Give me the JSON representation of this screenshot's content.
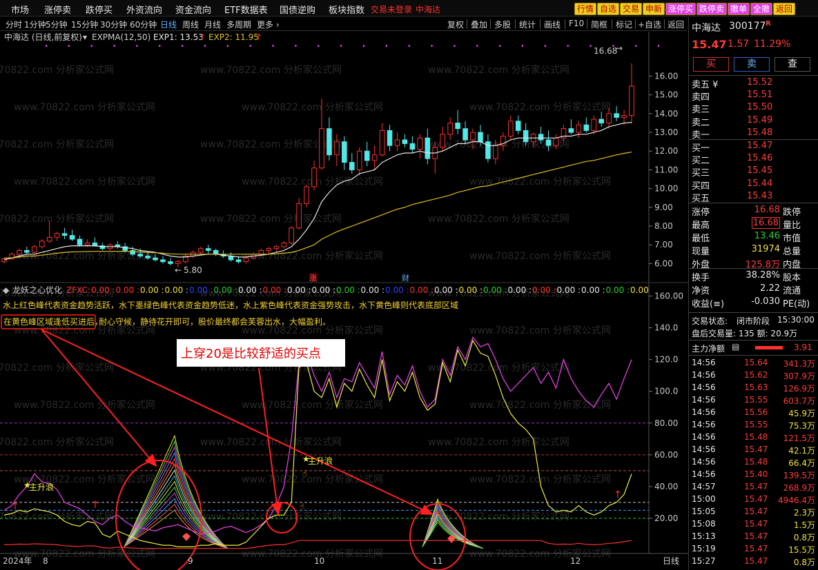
{
  "menu": {
    "items": [
      "市场",
      "涨停卖",
      "跌停买",
      "外资流向",
      "资金流向",
      "ETF数据表",
      "国债逆购",
      "板块指数"
    ],
    "login_status": "交易未登录",
    "stock_flag": "中海达",
    "quick_buttons": [
      {
        "label": "行情",
        "bg": "#f0d020",
        "fg": "#b00000"
      },
      {
        "label": "自选",
        "bg": "#f0d020",
        "fg": "#b00000"
      },
      {
        "label": "交易",
        "bg": "#f0d020",
        "fg": "#b00000"
      },
      {
        "label": "申新",
        "bg": "#f0d020",
        "fg": "#b00000"
      },
      {
        "label": "涨停买",
        "bg": "#e040e0",
        "fg": "#ffffff"
      },
      {
        "label": "跌停卖",
        "bg": "#e040e0",
        "fg": "#ffffff"
      },
      {
        "label": "撤单",
        "bg": "#e040e0",
        "fg": "#ffffff"
      },
      {
        "label": "全撤",
        "bg": "#e040e0",
        "fg": "#ffffff"
      },
      {
        "label": "返回",
        "bg": "#f0d020",
        "fg": "#b00000"
      }
    ]
  },
  "periods": {
    "items": [
      "分时",
      "1分钟",
      "5分钟",
      "15分钟",
      "30分钟",
      "60分钟",
      "日线",
      "周线",
      "月线",
      "多周期",
      "更多 ›"
    ],
    "active": "日线"
  },
  "tools": [
    "复权",
    "叠加",
    "多股",
    "统计",
    "画线",
    "F10",
    "简框",
    "标记",
    "+自选",
    "返回"
  ],
  "main_chart": {
    "title": "中海达 (日线,前复权)",
    "indicator": "EXPMA(12,50)",
    "exp1_label": "EXP1: 13.53",
    "exp1_arrow": "↑",
    "exp2_label": "EXP2: 11.95",
    "exp2_arrow": "↑",
    "high_label": "16.68",
    "low_label": "5.80",
    "event_zhang": "涨",
    "event_cai": "财",
    "y_ticks": [
      "16.00",
      "15.00",
      "14.00",
      "13.00",
      "12.00",
      "11.00",
      "10.00",
      "9.00",
      "8.00",
      "7.00",
      "6.00"
    ]
  },
  "sub_chart": {
    "title": "龙妖之心优化",
    "zfxc_label": "ZFXC:",
    "zfxc_values": [
      {
        "t": "0.00",
        "c": "#ff3030"
      },
      {
        "t": "0.00",
        "c": "#ff3030"
      },
      {
        "t": "0.00",
        "c": "#f0e040"
      },
      {
        "t": "0.00",
        "c": "#f0e040"
      },
      {
        "t": "0.00",
        "c": "#3040ff"
      },
      {
        "t": "0.00",
        "c": "#27d127"
      },
      {
        "t": "0.00",
        "c": "#e8e8e8"
      },
      {
        "t": "0.00",
        "c": "#ff3030"
      },
      {
        "t": "0.00",
        "c": "#e8e8e8"
      },
      {
        "t": "0.00",
        "c": "#e8e8e8"
      },
      {
        "t": "0.00",
        "c": "#27d127"
      },
      {
        "t": "0.00",
        "c": "#e8e8e8"
      },
      {
        "t": "0.00",
        "c": "#3040ff"
      },
      {
        "t": "0.00",
        "c": "#ff3030"
      },
      {
        "t": "0.00",
        "c": "#e8e8e8"
      },
      {
        "t": "0.00",
        "c": "#f0e040"
      },
      {
        "t": "0.00",
        "c": "#27d127"
      },
      {
        "t": "0.00",
        "c": "#e8e8e8"
      },
      {
        "t": "0.00",
        "c": "#ff3030"
      },
      {
        "t": "0.00",
        "c": "#e8e8e8"
      },
      {
        "t": "0.00",
        "c": "#e8e8e8"
      },
      {
        "t": "0.00",
        "c": "#27d127"
      },
      {
        "t": "0.00",
        "c": "#f0e040"
      }
    ],
    "desc1": "水上红色峰代表资金趋势活跃，水下墨绿色峰代表资金趋势低迷，水上紫色峰代表资金强势攻击，水下黄色峰则代表底部区域",
    "desc2_boxed": "在黄色峰区域逢低买进后，",
    "desc2_rest": "耐心守候，静待花开即可，股价最终都会芙蓉出水，大幅盈利。",
    "annotation": "上穿20是比较舒适的买点",
    "label_zsl": "主升浪",
    "y_ticks": [
      "160.00",
      "140.0",
      "120.0",
      "100.0",
      "80.00",
      "60.00",
      "40.00",
      "20.00"
    ]
  },
  "x_axis": {
    "year": "2024年",
    "labels": [
      "8",
      "9",
      "10",
      "11",
      "12"
    ],
    "period": "日线"
  },
  "watermark": "www.70822.com 分析家公式网",
  "quote": {
    "name": "中海达",
    "code": "300177",
    "flag": "R",
    "price": "15.47",
    "change": "1.57",
    "pct": "11.29%",
    "buy_label": "买",
    "sell_label": "卖",
    "query_label": "查",
    "asks": [
      {
        "label": "卖五 ¥",
        "price": "15.52"
      },
      {
        "label": "卖四",
        "price": "15.51"
      },
      {
        "label": "卖三",
        "price": "15.50"
      },
      {
        "label": "卖二",
        "price": "15.49"
      },
      {
        "label": "卖一",
        "price": "15.48"
      }
    ],
    "bids": [
      {
        "label": "买一",
        "price": "15.47"
      },
      {
        "label": "买二",
        "price": "15.46"
      },
      {
        "label": "买三",
        "price": "15.45"
      },
      {
        "label": "买四",
        "price": "15.44"
      },
      {
        "label": "买五",
        "price": "15.43"
      }
    ],
    "stats": [
      {
        "l1": "涨停",
        "v1": "16.68",
        "c1": "red",
        "l2": "跌停",
        "v2": "",
        "c2": "green"
      },
      {
        "l1": "最高",
        "v1": "16.68",
        "c1": "red",
        "l2": "量比",
        "v2": "",
        "c2": "white",
        "boxed": true
      },
      {
        "l1": "最低",
        "v1": "13.46",
        "c1": "green",
        "l2": "市值",
        "v2": "",
        "c2": "white"
      },
      {
        "l1": "现量",
        "v1": "31974",
        "c1": "yellow",
        "l2": "总量",
        "v2": "",
        "c2": "white"
      },
      {
        "l1": "外盘",
        "v1": "125.8万",
        "c1": "red",
        "l2": "内盘",
        "v2": "",
        "c2": "white"
      }
    ],
    "stats2": [
      {
        "l1": "换手",
        "v1": "38.28%",
        "l2": "股本"
      },
      {
        "l1": "净资",
        "v1": "2.22",
        "l2": "流通"
      },
      {
        "l1": "收益(≡)",
        "v1": "-0.030",
        "l2": "PE(动)"
      }
    ],
    "trade_status_label": "交易状态:",
    "trade_status": "闭市阶段",
    "trade_time": "15:30:00",
    "after_hours": "盘后交易量: 135  额: 20.9万",
    "main_net_label": "主力净额",
    "main_net_value": "3.91"
  },
  "ticks": [
    {
      "t": "14:56",
      "p": "15.64",
      "v": "341.3万",
      "pc": "red",
      "vc": "red"
    },
    {
      "t": "14:56",
      "p": "15.62",
      "v": "307.9万",
      "pc": "red",
      "vc": "red"
    },
    {
      "t": "14:56",
      "p": "15.63",
      "v": "126.9万",
      "pc": "red",
      "vc": "red"
    },
    {
      "t": "14:56",
      "p": "15.55",
      "v": "603.7万",
      "pc": "red",
      "vc": "red"
    },
    {
      "t": "14:56",
      "p": "15.56",
      "v": "45.9万",
      "pc": "red",
      "vc": "yellow"
    },
    {
      "t": "14:56",
      "p": "15.55",
      "v": "75.3万",
      "pc": "red",
      "vc": "yellow"
    },
    {
      "t": "14:56",
      "p": "15.48",
      "v": "121.5万",
      "pc": "red",
      "vc": "red"
    },
    {
      "t": "14:56",
      "p": "15.47",
      "v": "42.1万",
      "pc": "red",
      "vc": "yellow"
    },
    {
      "t": "14:56",
      "p": "15.48",
      "v": "66.4万",
      "pc": "red",
      "vc": "yellow"
    },
    {
      "t": "14:56",
      "p": "15.40",
      "v": "139.5万",
      "pc": "red",
      "vc": "red"
    },
    {
      "t": "14:57",
      "p": "15.47",
      "v": "268.9万",
      "pc": "red",
      "vc": "red"
    },
    {
      "t": "15:00",
      "p": "15.47",
      "v": "4946.4万",
      "pc": "red",
      "vc": "red"
    },
    {
      "t": "15:05",
      "p": "15.47",
      "v": "2.3万",
      "pc": "red",
      "vc": "yellow"
    },
    {
      "t": "15:08",
      "p": "15.47",
      "v": "1.5万",
      "pc": "red",
      "vc": "yellow"
    },
    {
      "t": "15:13",
      "p": "15.47",
      "v": "0.8万",
      "pc": "red",
      "vc": "yellow"
    },
    {
      "t": "15:19",
      "p": "15.47",
      "v": "15.5万",
      "pc": "red",
      "vc": "yellow"
    },
    {
      "t": "15:27",
      "p": "15.47",
      "v": "0.8万",
      "pc": "red",
      "vc": "yellow"
    }
  ],
  "chart_data": {
    "type": "candlestick",
    "ohlc": [
      [
        6.1,
        6.3,
        6.0,
        6.25
      ],
      [
        6.25,
        6.6,
        6.2,
        6.5
      ],
      [
        6.5,
        6.8,
        6.4,
        6.7
      ],
      [
        6.7,
        6.9,
        6.5,
        6.6
      ],
      [
        6.6,
        7.0,
        6.55,
        6.9
      ],
      [
        6.9,
        7.3,
        6.8,
        7.2
      ],
      [
        7.2,
        8.3,
        7.1,
        7.4
      ],
      [
        7.4,
        7.7,
        7.2,
        7.6
      ],
      [
        7.6,
        7.9,
        7.3,
        7.5
      ],
      [
        7.5,
        7.8,
        7.2,
        7.3
      ],
      [
        7.3,
        7.5,
        6.9,
        7.0
      ],
      [
        7.0,
        7.3,
        6.9,
        7.1
      ],
      [
        7.1,
        7.4,
        6.9,
        6.95
      ],
      [
        6.95,
        7.1,
        6.7,
        6.8
      ],
      [
        6.8,
        7.1,
        6.7,
        7.0
      ],
      [
        7.0,
        7.2,
        6.8,
        6.9
      ],
      [
        6.9,
        7.1,
        6.6,
        6.7
      ],
      [
        6.7,
        6.9,
        6.4,
        6.5
      ],
      [
        6.5,
        6.8,
        6.3,
        6.4
      ],
      [
        6.4,
        6.6,
        6.2,
        6.3
      ],
      [
        6.3,
        6.5,
        6.1,
        6.2
      ],
      [
        6.2,
        6.4,
        6.0,
        6.1
      ],
      [
        6.1,
        6.3,
        5.9,
        6.0
      ],
      [
        6.0,
        6.2,
        5.8,
        6.1
      ],
      [
        6.1,
        6.5,
        6.0,
        6.4
      ],
      [
        6.4,
        6.7,
        6.3,
        6.6
      ],
      [
        6.6,
        6.9,
        6.5,
        6.8
      ],
      [
        6.8,
        7.0,
        6.5,
        6.7
      ],
      [
        6.7,
        6.8,
        6.4,
        6.5
      ],
      [
        6.5,
        6.7,
        6.3,
        6.4
      ],
      [
        6.4,
        6.6,
        6.1,
        6.2
      ],
      [
        6.2,
        6.4,
        6.0,
        6.1
      ],
      [
        6.1,
        6.4,
        6.0,
        6.3
      ],
      [
        6.3,
        6.6,
        6.2,
        6.5
      ],
      [
        6.5,
        6.8,
        6.4,
        6.7
      ],
      [
        6.7,
        6.9,
        6.5,
        6.8
      ],
      [
        6.8,
        7.0,
        6.6,
        6.9
      ],
      [
        6.9,
        7.2,
        6.8,
        7.1
      ],
      [
        7.1,
        8.0,
        7.0,
        7.9
      ],
      [
        7.9,
        9.5,
        7.8,
        9.2
      ],
      [
        9.2,
        10.2,
        9.0,
        10.1
      ],
      [
        10.1,
        11.5,
        9.9,
        11.1
      ],
      [
        11.1,
        14.8,
        11.0,
        13.2
      ],
      [
        13.2,
        13.8,
        11.5,
        11.8
      ],
      [
        11.8,
        12.9,
        11.2,
        12.5
      ],
      [
        12.5,
        12.8,
        11.0,
        11.4
      ],
      [
        11.4,
        11.9,
        10.8,
        11.0
      ],
      [
        11.0,
        12.2,
        10.7,
        12.0
      ],
      [
        12.0,
        12.5,
        11.2,
        11.5
      ],
      [
        11.5,
        12.3,
        11.0,
        11.8
      ],
      [
        11.8,
        13.5,
        11.7,
        13.1
      ],
      [
        13.1,
        13.4,
        12.0,
        12.3
      ],
      [
        12.3,
        13.0,
        12.0,
        12.6
      ],
      [
        12.6,
        12.9,
        12.2,
        12.4
      ],
      [
        12.4,
        12.8,
        11.9,
        12.1
      ],
      [
        12.1,
        12.9,
        11.6,
        12.7
      ],
      [
        12.7,
        13.2,
        11.3,
        11.6
      ],
      [
        11.6,
        12.5,
        10.8,
        12.2
      ],
      [
        12.2,
        13.3,
        12.0,
        12.9
      ],
      [
        12.9,
        13.8,
        12.6,
        13.5
      ],
      [
        13.5,
        14.2,
        12.9,
        13.2
      ],
      [
        13.2,
        13.6,
        12.4,
        12.6
      ],
      [
        12.6,
        13.2,
        12.1,
        13.0
      ],
      [
        13.0,
        13.4,
        12.3,
        12.5
      ],
      [
        12.5,
        12.9,
        11.4,
        11.6
      ],
      [
        11.6,
        12.6,
        11.3,
        12.3
      ],
      [
        12.3,
        13.0,
        12.0,
        12.8
      ],
      [
        12.8,
        13.9,
        12.6,
        13.6
      ],
      [
        13.6,
        13.9,
        12.9,
        13.1
      ],
      [
        13.1,
        13.5,
        12.3,
        12.5
      ],
      [
        12.5,
        13.0,
        12.2,
        12.9
      ],
      [
        12.9,
        13.3,
        12.4,
        12.6
      ],
      [
        12.6,
        13.1,
        12.0,
        12.3
      ],
      [
        12.3,
        12.9,
        12.1,
        12.7
      ],
      [
        12.7,
        13.4,
        12.5,
        13.2
      ],
      [
        13.2,
        13.7,
        12.9,
        13.0
      ],
      [
        13.0,
        13.6,
        12.7,
        13.4
      ],
      [
        13.4,
        13.8,
        13.0,
        13.1
      ],
      [
        13.1,
        13.9,
        12.9,
        13.7
      ],
      [
        13.7,
        14.1,
        13.3,
        13.5
      ],
      [
        13.5,
        14.3,
        13.2,
        14.0
      ],
      [
        14.0,
        14.4,
        13.6,
        13.8
      ],
      [
        13.8,
        14.2,
        13.4,
        13.9
      ],
      [
        13.9,
        16.68,
        13.46,
        15.47
      ]
    ],
    "exp1": [
      6.2,
      6.3,
      6.4,
      6.5,
      6.5,
      6.6,
      6.7,
      6.8,
      6.9,
      6.95,
      6.95,
      6.95,
      6.95,
      6.9,
      6.9,
      6.9,
      6.85,
      6.8,
      6.7,
      6.65,
      6.6,
      6.5,
      6.4,
      6.35,
      6.35,
      6.4,
      6.45,
      6.5,
      6.5,
      6.45,
      6.4,
      6.35,
      6.35,
      6.4,
      6.45,
      6.5,
      6.6,
      6.7,
      6.9,
      7.3,
      7.8,
      8.4,
      9.3,
      9.8,
      10.2,
      10.4,
      10.5,
      10.8,
      10.9,
      11.0,
      11.4,
      11.6,
      11.8,
      11.9,
      11.9,
      12.0,
      11.9,
      11.9,
      12.0,
      12.2,
      12.4,
      12.4,
      12.5,
      12.5,
      12.3,
      12.3,
      12.4,
      12.6,
      12.7,
      12.7,
      12.7,
      12.7,
      12.7,
      12.7,
      12.8,
      12.8,
      12.9,
      12.9,
      13.0,
      13.1,
      13.3,
      13.4,
      13.5,
      13.53
    ],
    "exp2": [
      6.3,
      6.3,
      6.35,
      6.4,
      6.4,
      6.45,
      6.5,
      6.55,
      6.6,
      6.62,
      6.63,
      6.64,
      6.65,
      6.65,
      6.65,
      6.65,
      6.65,
      6.64,
      6.62,
      6.6,
      6.58,
      6.55,
      6.52,
      6.5,
      6.5,
      6.5,
      6.5,
      6.5,
      6.5,
      6.5,
      6.5,
      6.5,
      6.5,
      6.5,
      6.5,
      6.5,
      6.52,
      6.55,
      6.6,
      6.7,
      6.85,
      7.0,
      7.3,
      7.5,
      7.7,
      7.85,
      8.0,
      8.15,
      8.3,
      8.45,
      8.6,
      8.75,
      8.9,
      9.0,
      9.15,
      9.25,
      9.35,
      9.45,
      9.55,
      9.65,
      9.8,
      9.9,
      10.0,
      10.1,
      10.15,
      10.25,
      10.35,
      10.45,
      10.55,
      10.65,
      10.75,
      10.85,
      10.95,
      11.05,
      11.15,
      11.25,
      11.35,
      11.45,
      11.5,
      11.6,
      11.7,
      11.8,
      11.88,
      11.95
    ],
    "price_ylim": [
      5.5,
      16.9
    ],
    "osc_ylim": [
      0,
      165
    ],
    "osc_magenta": [
      25,
      28,
      35,
      40,
      48,
      43,
      42,
      38,
      30,
      28,
      26,
      22,
      18,
      16,
      20,
      22,
      18,
      15,
      14,
      13,
      12,
      14,
      15,
      16,
      14,
      12,
      10,
      11,
      12,
      14,
      15,
      13,
      11,
      13,
      16,
      20,
      28,
      40,
      70,
      118,
      125,
      110,
      100,
      112,
      96,
      108,
      106,
      118,
      110,
      102,
      125,
      98,
      110,
      104,
      116,
      100,
      90,
      95,
      120,
      110,
      128,
      120,
      134,
      128,
      130,
      120,
      108,
      100,
      105,
      110,
      115,
      105,
      112,
      102,
      120,
      108,
      100,
      94,
      90,
      98,
      105,
      95,
      108,
      120
    ],
    "osc_yellow": [
      22,
      23,
      25,
      24,
      26,
      25,
      24,
      22,
      18,
      16,
      15,
      18,
      17,
      10,
      8,
      12,
      10,
      8,
      6,
      5,
      4,
      3,
      3,
      2,
      2,
      2,
      3,
      3,
      4,
      3,
      3,
      3,
      5,
      10,
      15,
      20,
      22,
      22,
      30,
      115,
      118,
      100,
      96,
      108,
      90,
      105,
      100,
      114,
      104,
      96,
      120,
      94,
      106,
      100,
      112,
      96,
      88,
      92,
      118,
      106,
      126,
      116,
      132,
      124,
      122,
      110,
      96,
      86,
      80,
      76,
      70,
      40,
      28,
      24,
      25,
      24,
      28,
      24,
      22,
      24,
      28,
      30,
      35,
      48
    ]
  }
}
